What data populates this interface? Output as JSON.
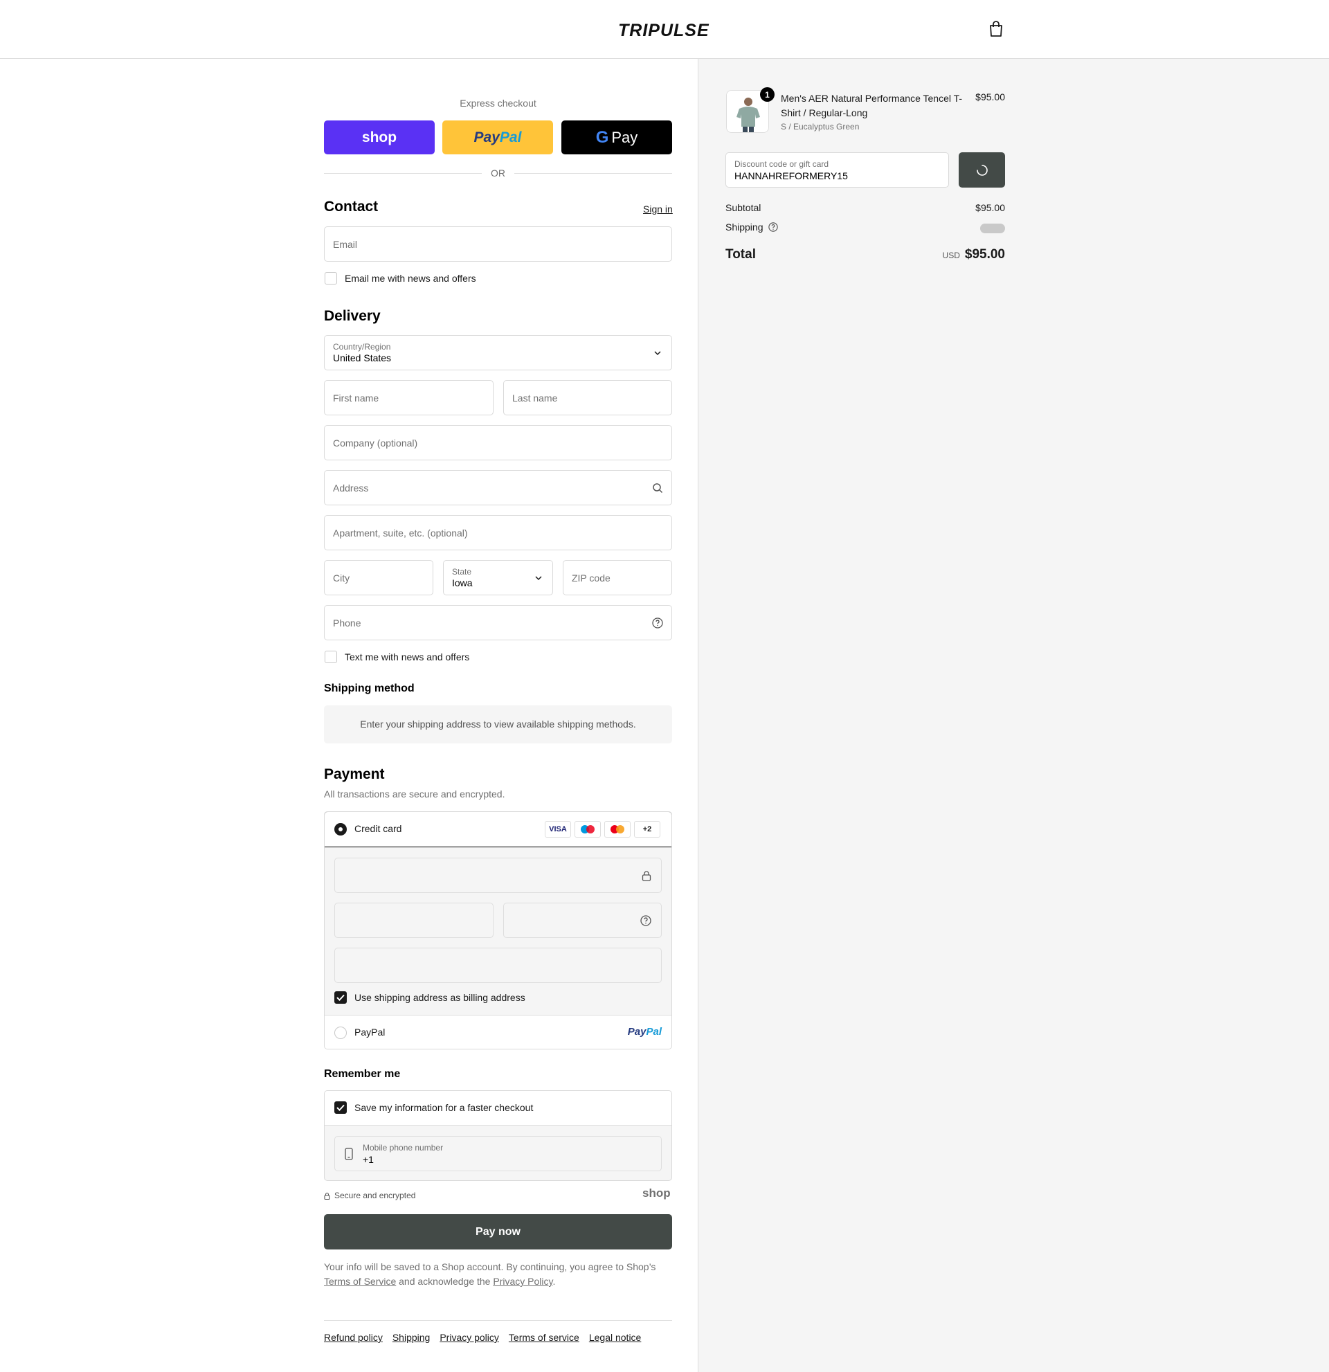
{
  "header": {
    "brand": "TRIPULSE"
  },
  "express": {
    "label": "Express checkout",
    "shop_label": "shop",
    "paypal_label_a": "Pay",
    "paypal_label_b": "Pal",
    "gpay_label": "Pay",
    "or_label": "OR"
  },
  "contact": {
    "heading": "Contact",
    "sign_in": "Sign in",
    "email_placeholder": "Email",
    "news_checkbox": "Email me with news and offers"
  },
  "delivery": {
    "heading": "Delivery",
    "country_label": "Country/Region",
    "country_value": "United States",
    "first_name": "First name",
    "last_name": "Last name",
    "company": "Company (optional)",
    "address": "Address",
    "apartment": "Apartment, suite, etc. (optional)",
    "city": "City",
    "state_label": "State",
    "state_value": "Iowa",
    "zip": "ZIP code",
    "phone": "Phone",
    "text_checkbox": "Text me with news and offers"
  },
  "shipping_method": {
    "heading": "Shipping method",
    "note": "Enter your shipping address to view available shipping methods."
  },
  "payment": {
    "heading": "Payment",
    "subtitle": "All transactions are secure and encrypted.",
    "credit_card": "Credit card",
    "cards": [
      "VISA",
      "+2"
    ],
    "billing_checkbox": "Use shipping address as billing address",
    "paypal": "PayPal",
    "paypal_logo_a": "Pay",
    "paypal_logo_b": "Pal"
  },
  "remember": {
    "heading": "Remember me",
    "save_checkbox": "Save my information for a faster checkout",
    "phone_label": "Mobile phone number",
    "phone_value": "+1",
    "secure": "Secure and encrypted",
    "shop_logo": "shop"
  },
  "pay_now": "Pay now",
  "legal": {
    "text_1": "Your info will be saved to a Shop account. By continuing, you agree to Shop’s",
    "terms": "Terms of Service",
    "text_2": "and acknowledge the",
    "privacy": "Privacy Policy",
    "text_3": "."
  },
  "footer": [
    "Refund policy",
    "Shipping",
    "Privacy policy",
    "Terms of service",
    "Legal notice"
  ],
  "summary": {
    "quantity": "1",
    "product_name": "Men's AER Natural Performance Tencel T-Shirt / Regular-Long",
    "variant": "S / Eucalyptus Green",
    "price": "$95.00",
    "discount_label": "Discount code or gift card",
    "discount_value": "HANNAHREFORMERY15",
    "subtotal_label": "Subtotal",
    "subtotal_value": "$95.00",
    "shipping_label": "Shipping",
    "total_label": "Total",
    "currency": "USD",
    "total_value": "$95.00"
  },
  "colors": {
    "shop_purple": "#5a31f4",
    "paypal_yellow": "#ffc439",
    "primary_button": "#434a47"
  }
}
